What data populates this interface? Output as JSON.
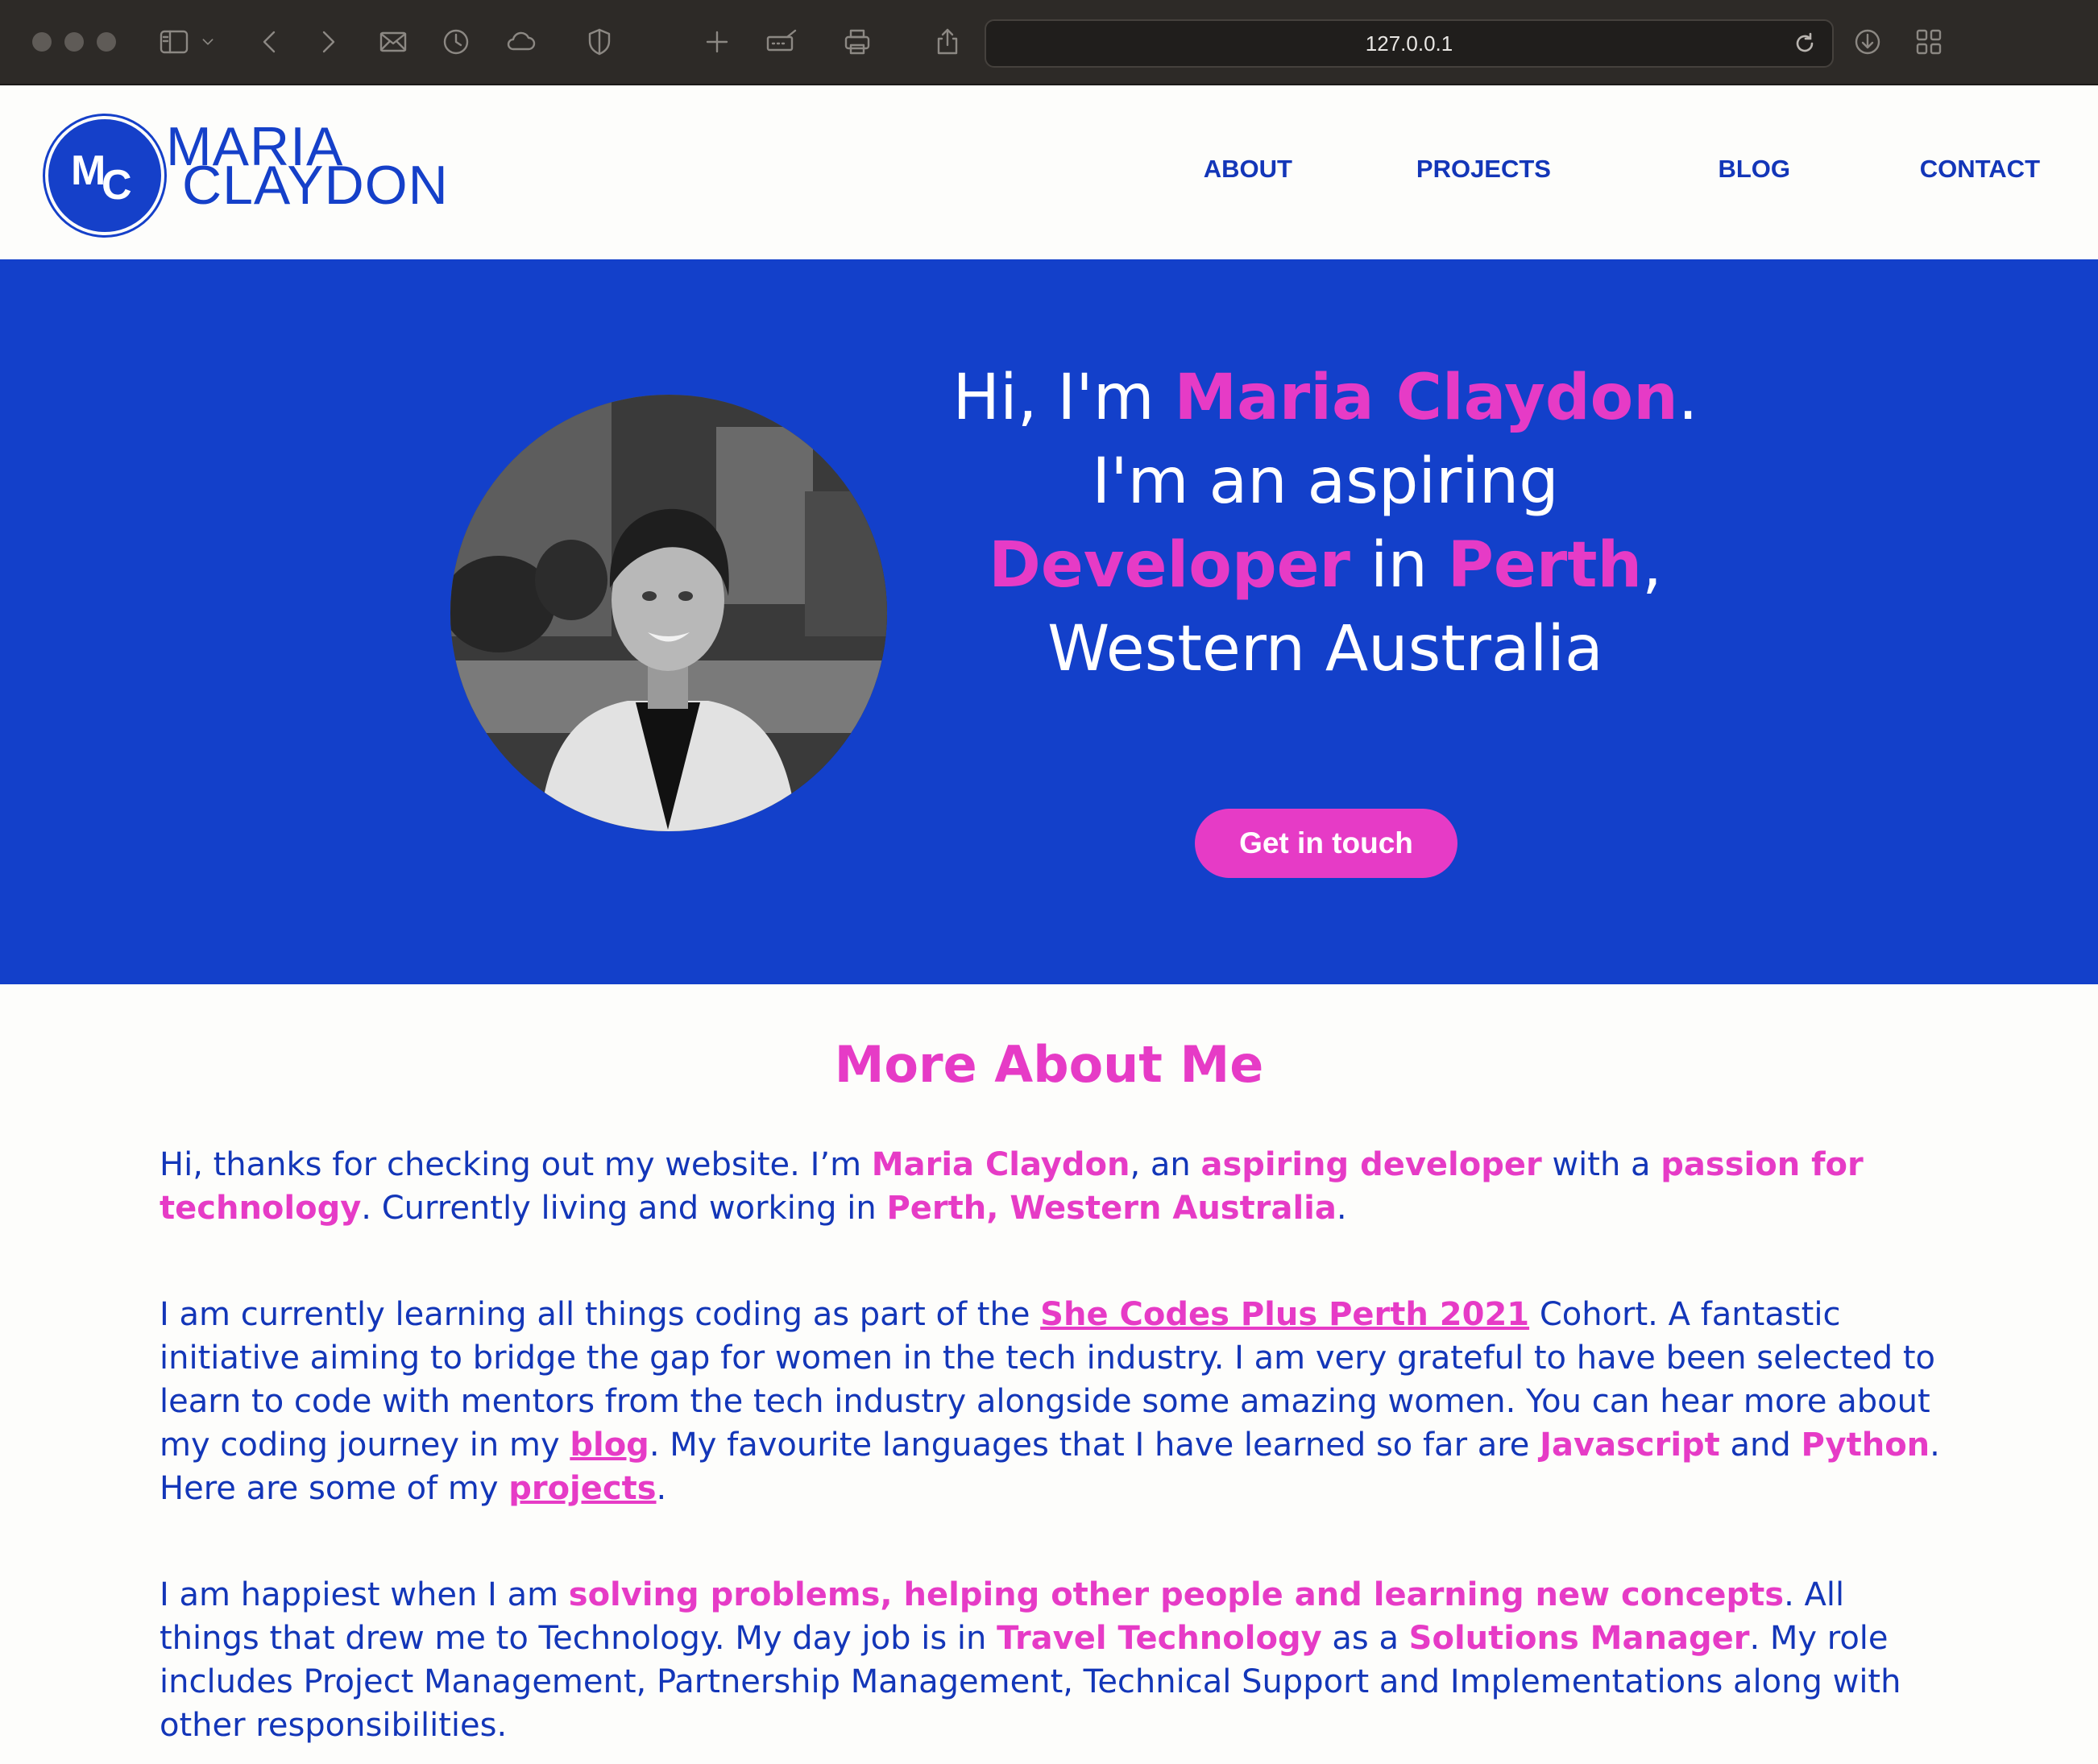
{
  "browser": {
    "url": "127.0.0.1"
  },
  "header": {
    "logo": {
      "monogram_m": "M",
      "monogram_c": "C",
      "line1": "MARIA",
      "line2": "CLAYDON"
    },
    "nav": [
      {
        "label": "ABOUT"
      },
      {
        "label": "PROJECTS"
      },
      {
        "label": "BLOG"
      },
      {
        "label": "CONTACT"
      }
    ]
  },
  "hero": {
    "greeting": "Hi, I'm ",
    "name": "Maria Claydon",
    "mid": ". I'm an aspiring ",
    "role": "Developer",
    "in": " in ",
    "city": "Perth",
    "region": ", Western Australia",
    "cta_label": "Get in touch",
    "colors": {
      "background": "#1340ca",
      "accent": "#e63bc6"
    }
  },
  "about": {
    "heading": "More About Me",
    "p1": {
      "t1": "Hi, thanks for checking out my website. I’m ",
      "name": "Maria Claydon",
      "t2": ", an ",
      "role": "aspiring developer",
      "t3": " with a ",
      "passion": "passion for technology",
      "t4": ". Currently living and working in ",
      "location": "Perth, Western Australia",
      "t5": "."
    },
    "p2": {
      "t1": "I am currently learning all things coding as part of the ",
      "cohort_link": "She Codes Plus Perth 2021",
      "t2": " Cohort. A fantastic initiative aiming to bridge the gap for women in the tech industry. I am very grateful to have been selected to learn to code with mentors from the tech industry alongside some amazing women. You can hear more about my coding journey in my ",
      "blog_link": "blog",
      "t3": ". My favourite languages that I have learned so far are ",
      "lang1": "Javascript",
      "t4": " and ",
      "lang2": "Python",
      "t5": ". Here are some of my ",
      "projects_link": "projects",
      "t6": "."
    },
    "p3": {
      "t1": "I am happiest when I am ",
      "happiest": "solving problems, helping other people and learning new concepts",
      "t2": ". All things that drew me to Technology. My day job is in ",
      "industry": "Travel Technology",
      "t3": " as a ",
      "title": "Solutions Manager",
      "t4": ". My role includes Project Management, Partnership Management, Technical Support and Implementations along with other responsibilities."
    }
  }
}
